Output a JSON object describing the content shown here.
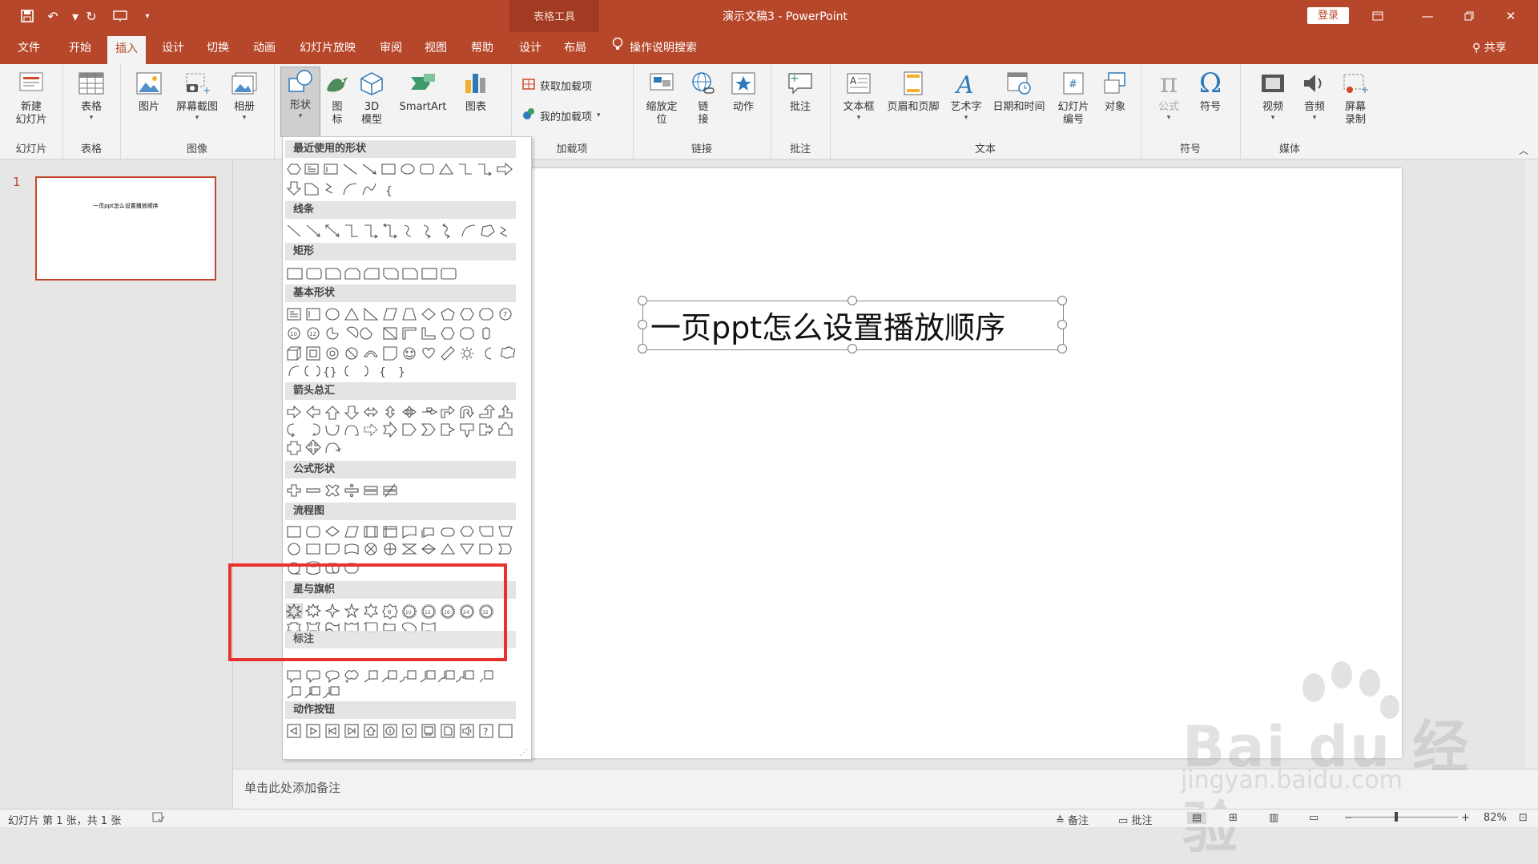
{
  "app": {
    "contextual_title": "表格工具",
    "doc_title": "演示文稿3  -  PowerPoint",
    "login": "登录",
    "share": "共享",
    "search_tip": "操作说明搜索"
  },
  "tabs": [
    {
      "label": "文件"
    },
    {
      "label": "开始"
    },
    {
      "label": "插入",
      "active": true
    },
    {
      "label": "设计"
    },
    {
      "label": "切换"
    },
    {
      "label": "动画"
    },
    {
      "label": "幻灯片放映"
    },
    {
      "label": "审阅"
    },
    {
      "label": "视图"
    },
    {
      "label": "帮助"
    },
    {
      "label": "设计"
    },
    {
      "label": "布局"
    }
  ],
  "ribbon": {
    "groups": {
      "slides": "幻灯片",
      "tables": "表格",
      "images": "图像",
      "addins": "加载项",
      "links": "链接",
      "comments": "批注",
      "text": "文本",
      "symbols": "符号",
      "media": "媒体"
    },
    "buttons": {
      "new_slide": "新建\n幻灯片",
      "table": "表格",
      "picture": "图片",
      "screenshot": "屏幕截图",
      "album": "相册",
      "shapes": "形状",
      "icons": "图\n标",
      "model3d": "3D\n模型",
      "smartart": "SmartArt",
      "chart": "图表",
      "get_addins": "获取加载项",
      "my_addins": "我的加载项",
      "zoom": "缩放定\n位",
      "link": "链\n接",
      "action": "动作",
      "comment": "批注",
      "textbox": "文本框",
      "header_footer": "页眉和页脚",
      "wordart": "艺术字",
      "datetime": "日期和时间",
      "slide_number": "幻灯片\n编号",
      "object": "对象",
      "equation": "公式",
      "symbol": "符号",
      "video": "视频",
      "audio": "音频",
      "screen_record": "屏幕\n录制"
    }
  },
  "shapes_panel": {
    "categories": [
      "最近使用的形状",
      "线条",
      "矩形",
      "基本形状",
      "箭头总汇",
      "公式形状",
      "流程图",
      "星与旗帜",
      "标注",
      "动作按钮"
    ]
  },
  "thumbnail": {
    "number": "1",
    "text": "一页ppt怎么设置播放顺序"
  },
  "slide": {
    "title": "一页ppt怎么设置播放顺序"
  },
  "notes_placeholder": "单击此处添加备注",
  "status": {
    "slide_info": "幻灯片 第 1 张，共 1 张",
    "notes": "备注",
    "comments": "批注",
    "zoom": "82%"
  },
  "watermark": {
    "brand": "Bai du 经验",
    "url": "jingyan.baidu.com"
  }
}
